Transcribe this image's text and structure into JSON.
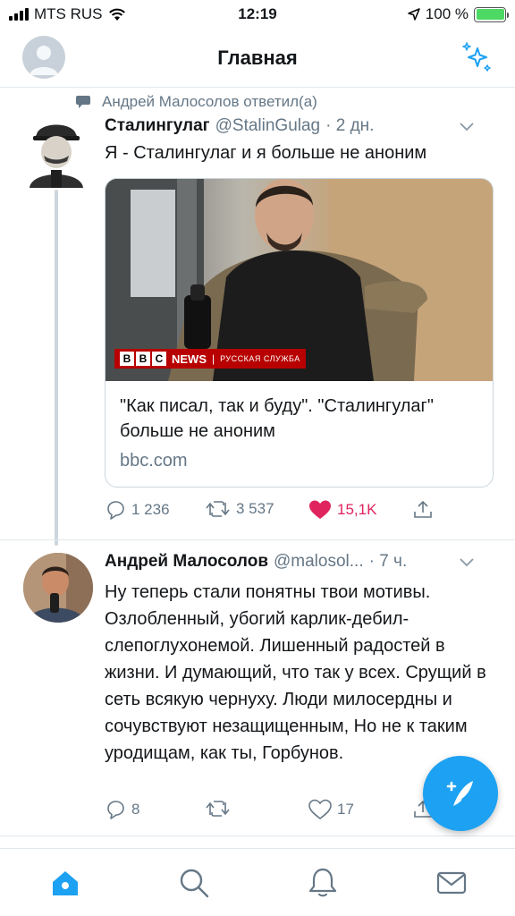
{
  "status_bar": {
    "carrier": "MTS RUS",
    "time": "12:19",
    "battery_percent": "100 %"
  },
  "header": {
    "title": "Главная"
  },
  "retweet_context": "Андрей Малосолов ответил(а)",
  "tweet1": {
    "name": "Сталингулаг",
    "handle": "@StalinGulag",
    "time": "· 2 дн.",
    "text": "Я - Сталингулаг и я больше не аноним",
    "card": {
      "brand_blocks": [
        "B",
        "B",
        "C"
      ],
      "brand_news": "NEWS",
      "brand_service": "РУССКАЯ СЛУЖБА",
      "title": "\"Как писал, так и буду\". \"Сталингулаг\" больше не аноним",
      "url": "bbc.com"
    },
    "replies": "1 236",
    "retweets": "3 537",
    "likes": "15,1K"
  },
  "tweet2": {
    "name": "Андрей Малосолов",
    "handle": "@malosol...",
    "time": "· 7 ч.",
    "text": "Ну теперь стали понятны твои мотивы. Озлобленный, убогий карлик-дебил-слепоглухонемой. Лишенный радостей в жизни. И думающий, что так у всех. Срущий в сеть всякую чернуху. Люди милосердны и сочувствуют незащищенным, Но не к таким уродищам, как ты, Горбунов.",
    "replies": "8",
    "likes": "17"
  },
  "colors": {
    "accent": "#1da1f2",
    "like": "#e0245e",
    "muted": "#657786",
    "border": "#e1e8ed"
  },
  "icons": [
    "signal-icon",
    "wifi-icon",
    "location-icon",
    "battery-icon",
    "sparkle-icon",
    "reply-icon",
    "retweet-icon",
    "heart-icon",
    "share-icon",
    "compose-icon",
    "home-icon",
    "search-icon",
    "bell-icon",
    "mail-icon",
    "chevron-down-icon"
  ]
}
